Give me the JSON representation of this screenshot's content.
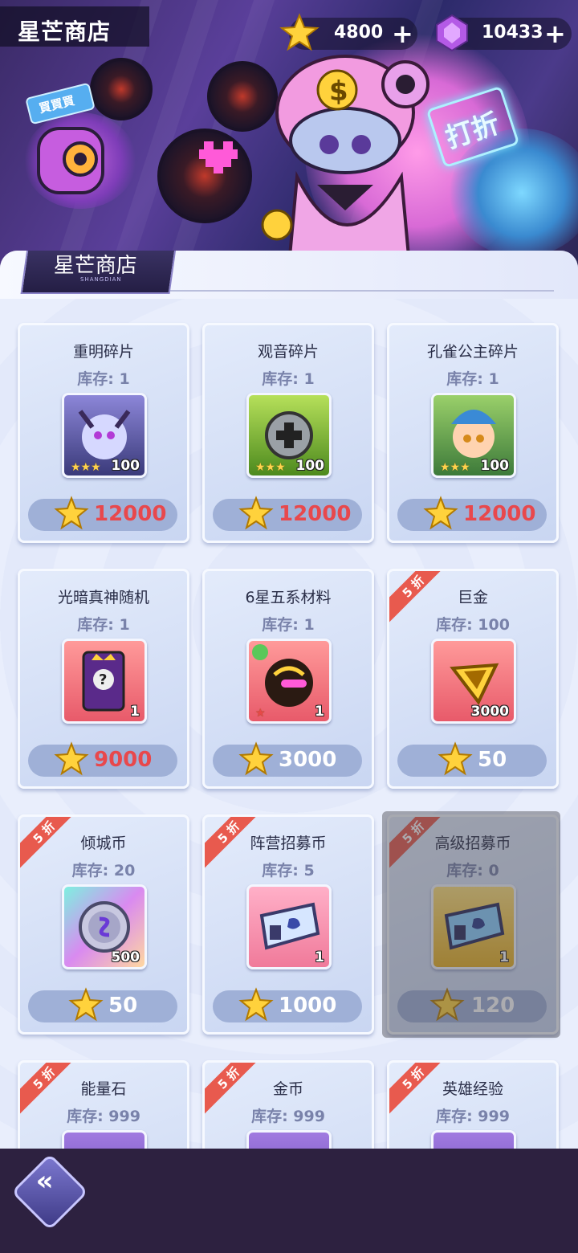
{
  "header": {
    "title": "星芒商店",
    "currencies": [
      {
        "name": "star-coin",
        "value": "4800",
        "plus": "+"
      },
      {
        "name": "purple-gem",
        "value": "10433",
        "plus": "+"
      }
    ],
    "banner_sign_buy": "買買買",
    "banner_sign_sale": "打折"
  },
  "panel": {
    "tab_title": "星芒商店",
    "tab_subtitle": "SHANGDIAN"
  },
  "items": [
    {
      "name": "重明碎片",
      "stock": "库存: 1",
      "level": "100",
      "price": "12000"
    },
    {
      "name": "观音碎片",
      "stock": "库存: 1",
      "level": "100",
      "price": "12000"
    },
    {
      "name": "孔雀公主碎片",
      "stock": "库存: 1",
      "level": "100",
      "price": "12000"
    },
    {
      "name": "光暗真神随机",
      "stock": "库存: 1",
      "qty": "1",
      "price": "9000"
    },
    {
      "name": "6星五系材料",
      "stock": "库存: 1",
      "qty": "1",
      "price": "3000"
    },
    {
      "name": "巨金",
      "stock": "库存: 100",
      "qty": "3000",
      "price": "50",
      "discount": "5 折"
    },
    {
      "name": "倾城币",
      "stock": "库存: 20",
      "qty": "500",
      "price": "50",
      "discount": "5 折"
    },
    {
      "name": "阵营招募币",
      "stock": "库存: 5",
      "qty": "1",
      "price": "1000",
      "discount": "5 折"
    },
    {
      "name": "高级招募币",
      "stock": "库存: 0",
      "qty": "1",
      "price": "120",
      "discount": "5 折",
      "sold_out": true
    },
    {
      "name": "能量石",
      "stock": "库存: 999",
      "discount": "5 折"
    },
    {
      "name": "金币",
      "stock": "库存: 999",
      "discount": "5 折"
    },
    {
      "name": "英雄经验",
      "stock": "库存: 999",
      "discount": "5 折"
    }
  ],
  "colors": {
    "price_red": "#e8484c",
    "price_white": "#ffffff",
    "discount": "#e85a4e",
    "bottom_bar": "#2d2140"
  },
  "footer": {
    "back_icon": "double-chevron-left-icon",
    "back_label": "«"
  }
}
